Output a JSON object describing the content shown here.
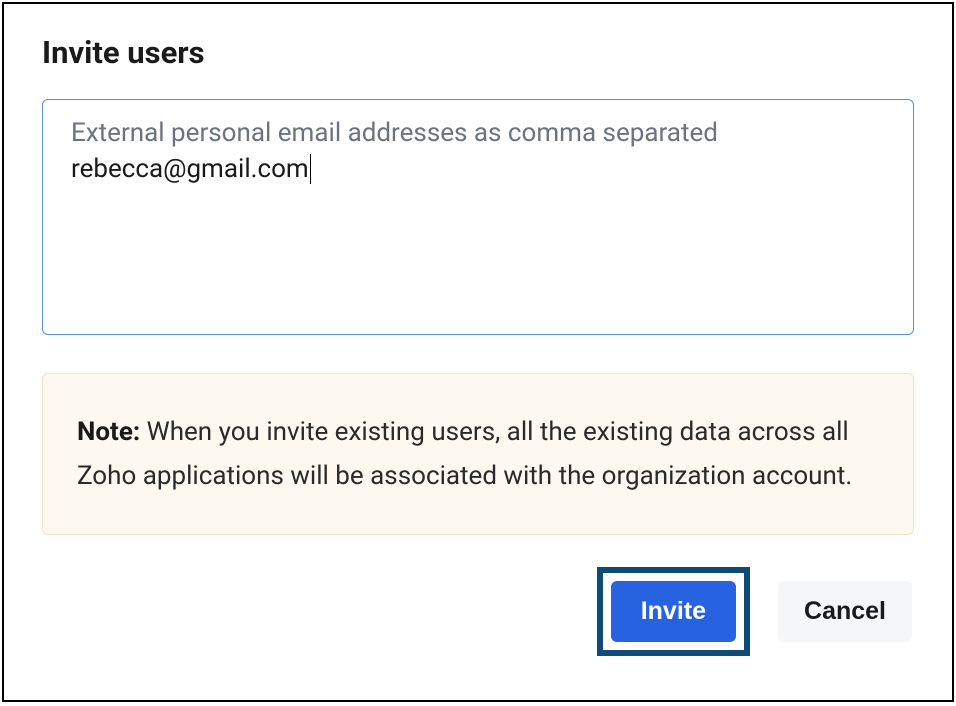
{
  "dialog": {
    "title": "Invite users",
    "email_input": {
      "placeholder": "External personal email addresses as comma separated",
      "value": "rebecca@gmail.com"
    },
    "note": {
      "label": "Note:",
      "text": " When you invite existing users, all the existing data across all Zoho applications will be associated with the organization account."
    },
    "buttons": {
      "invite": "Invite",
      "cancel": "Cancel"
    }
  }
}
